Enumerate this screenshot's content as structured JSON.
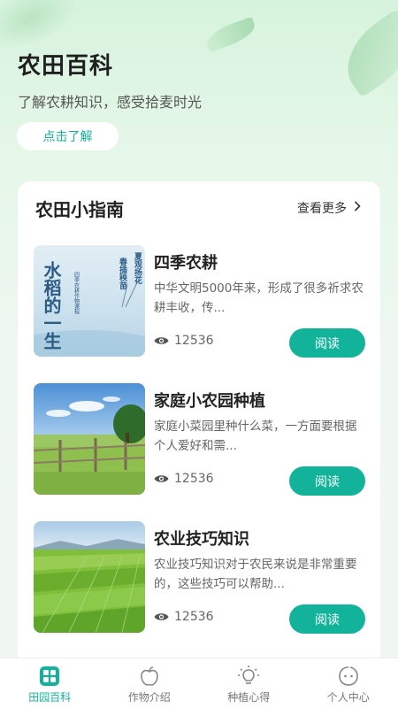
{
  "hero": {
    "title": "农田百科",
    "subtitle": "了解农耕知识，感受拾麦时光",
    "button_label": "点击了解"
  },
  "guide": {
    "title": "农田小指南",
    "more_label": "查看更多"
  },
  "articles": [
    {
      "title": "四季农耕",
      "desc": "中华文明5000年来，形成了很多祈求农耕丰收，传...",
      "views": "12536",
      "read_label": "阅读",
      "thumb_text": {
        "main": "水稻的一生",
        "side": "四季农耕作物课程",
        "right1": "春插秧苗",
        "right2": "夏观扬花"
      }
    },
    {
      "title": "家庭小农园种植",
      "desc": "家庭小菜园里种什么菜，一方面要根据个人爱好和需...",
      "views": "12536",
      "read_label": "阅读"
    },
    {
      "title": "农业技巧知识",
      "desc": "农业技巧知识对于农民来说是非常重要的，这些技巧可以帮助...",
      "views": "12536",
      "read_label": "阅读"
    }
  ],
  "tabs": [
    {
      "label": "田园百科",
      "icon": "grid-icon",
      "active": true
    },
    {
      "label": "作物介绍",
      "icon": "apple-icon",
      "active": false
    },
    {
      "label": "种植心得",
      "icon": "lightbulb-icon",
      "active": false
    },
    {
      "label": "个人中心",
      "icon": "face-icon",
      "active": false
    }
  ],
  "colors": {
    "accent": "#12b39a",
    "inactive": "#777777"
  }
}
